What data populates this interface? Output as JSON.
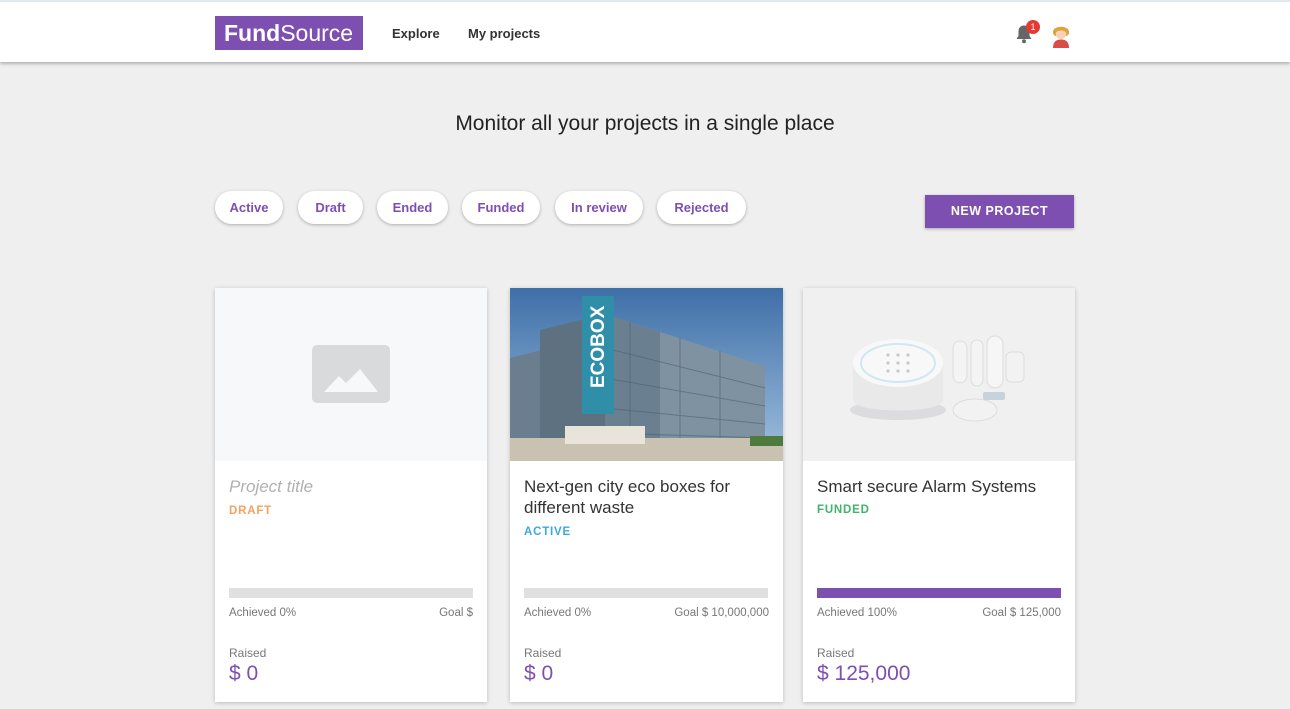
{
  "brand": {
    "bold": "Fund",
    "regular": "Source",
    "color": "#7d4fb1"
  },
  "nav": {
    "explore": "Explore",
    "my_projects": "My projects"
  },
  "notifications": {
    "count": "1"
  },
  "headline": "Monitor all your projects in a single place",
  "filters": [
    "Active",
    "Draft",
    "Ended",
    "Funded",
    "In review",
    "Rejected"
  ],
  "new_project_label": "NEW PROJECT",
  "projects": [
    {
      "title": "Project title",
      "status": "DRAFT",
      "status_color": "#f4a261",
      "progress": 0,
      "achieved": "Achieved 0%",
      "goal": "Goal $",
      "raised_label": "Raised",
      "raised": "$ 0",
      "image": "placeholder-image"
    },
    {
      "title": "Next-gen city eco boxes for different waste",
      "status": "ACTIVE",
      "status_color": "#3da9e0",
      "progress": 0,
      "achieved": "Achieved 0%",
      "goal": "Goal $ 10,000,000",
      "raised_label": "Raised",
      "raised": "$ 0",
      "image": "ecobox-building-photo",
      "image_text": "ECOBOX"
    },
    {
      "title": "Smart secure Alarm Systems",
      "status": "FUNDED",
      "status_color": "#43b36b",
      "progress": 1.0,
      "achieved": "Achieved 100%",
      "goal": "Goal $ 125,000",
      "raised_label": "Raised",
      "raised": "$ 125,000",
      "image": "alarm-system-photo"
    }
  ]
}
